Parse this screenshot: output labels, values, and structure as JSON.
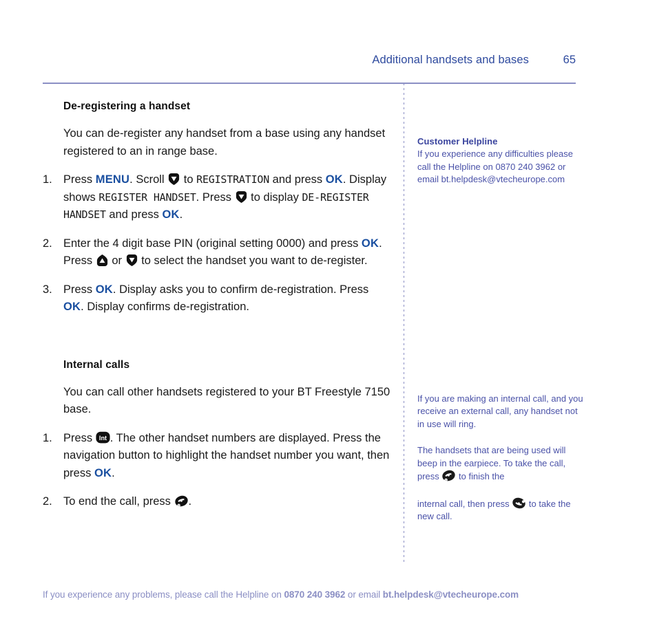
{
  "header": {
    "title": "Additional handsets and bases",
    "page_number": "65",
    "color": "#2e4a9e",
    "rule_color": "#8b8fc4"
  },
  "main": {
    "section1": {
      "heading": "De-registering a handset",
      "intro": "You can de-register any handset from a base using any handset registered to an in range base.",
      "steps": [
        {
          "num": "1.",
          "parts": [
            {
              "t": "text",
              "v": "Press "
            },
            {
              "t": "kw",
              "v": "MENU"
            },
            {
              "t": "text",
              "v": ". Scroll "
            },
            {
              "t": "icon",
              "v": "down-arrow-key-icon"
            },
            {
              "t": "text",
              "v": " to "
            },
            {
              "t": "lcd",
              "v": "REGISTRATION"
            },
            {
              "t": "text",
              "v": " and press "
            },
            {
              "t": "kw",
              "v": "OK"
            },
            {
              "t": "text",
              "v": ". Display shows "
            },
            {
              "t": "lcd",
              "v": "REGISTER HANDSET"
            },
            {
              "t": "text",
              "v": ". Press "
            },
            {
              "t": "icon",
              "v": "down-arrow-key-icon"
            },
            {
              "t": "text",
              "v": " to display "
            },
            {
              "t": "lcd",
              "v": "DE-REGISTER HANDSET"
            },
            {
              "t": "text",
              "v": " and press "
            },
            {
              "t": "kw",
              "v": "OK"
            },
            {
              "t": "text",
              "v": "."
            }
          ]
        },
        {
          "num": "2.",
          "parts": [
            {
              "t": "text",
              "v": "Enter the 4 digit base PIN (original setting 0000) and press "
            },
            {
              "t": "kw",
              "v": "OK"
            },
            {
              "t": "text",
              "v": ". Press "
            },
            {
              "t": "icon",
              "v": "up-arrow-key-icon"
            },
            {
              "t": "text",
              "v": " or "
            },
            {
              "t": "icon",
              "v": "down-arrow-key-icon"
            },
            {
              "t": "text",
              "v": " to select the handset you want to de-register."
            }
          ]
        },
        {
          "num": "3.",
          "parts": [
            {
              "t": "text",
              "v": "Press "
            },
            {
              "t": "kw",
              "v": "OK"
            },
            {
              "t": "text",
              "v": ". Display asks you to confirm de-registration. Press "
            },
            {
              "t": "kw",
              "v": "OK"
            },
            {
              "t": "text",
              "v": ". Display confirms de-registration."
            }
          ]
        }
      ]
    },
    "section2": {
      "heading": "Internal calls",
      "intro": "You can call other handsets registered to your BT Freestyle 7150 base.",
      "steps": [
        {
          "num": "1.",
          "parts": [
            {
              "t": "text",
              "v": "Press "
            },
            {
              "t": "icon",
              "v": "int-key-icon"
            },
            {
              "t": "text",
              "v": ". The other handset numbers are displayed. Press the navigation button to highlight the handset number you want, then press "
            },
            {
              "t": "kw",
              "v": "OK"
            },
            {
              "t": "text",
              "v": "."
            }
          ]
        },
        {
          "num": "2.",
          "parts": [
            {
              "t": "text",
              "v": "To end the call, press "
            },
            {
              "t": "icon",
              "v": "end-call-key-icon"
            },
            {
              "t": "text",
              "v": "."
            }
          ]
        }
      ]
    }
  },
  "sidebar": {
    "helpline": {
      "heading": "Customer Helpline",
      "body": "If you experience any difficulties please call the Helpline on 0870 240 3962 or email bt.helpdesk@vtecheurope.com"
    },
    "note1": "If you are making an internal call, and you receive an external call, any handset not in use will ring.",
    "note2_parts": [
      {
        "t": "text",
        "v": "The handsets that are being used will beep in the earpiece. To take the call, press "
      },
      {
        "t": "icon",
        "v": "end-call-key-icon"
      },
      {
        "t": "text",
        "v": " to finish the"
      }
    ],
    "note3_parts": [
      {
        "t": "text",
        "v": "internal call, then press "
      },
      {
        "t": "icon",
        "v": "talk-key-icon"
      },
      {
        "t": "text",
        "v": " to take the new call."
      }
    ],
    "color": "#4a52a8",
    "heading_color": "#3a449e"
  },
  "footer": {
    "parts": [
      {
        "t": "text",
        "v": "If you experience any problems, please call the Helpline on "
      },
      {
        "t": "bold",
        "v": "0870 240 3962"
      },
      {
        "t": "text",
        "v": " or email "
      },
      {
        "t": "bold",
        "v": "bt.helpdesk@vtecheurope.com"
      }
    ],
    "color": "#8b8fc4"
  },
  "icons": {
    "down-arrow-key-icon": "down-arrow-key-icon",
    "up-arrow-key-icon": "up-arrow-key-icon",
    "int-key-icon": "int-key-icon",
    "end-call-key-icon": "end-call-key-icon",
    "talk-key-icon": "talk-key-icon"
  }
}
